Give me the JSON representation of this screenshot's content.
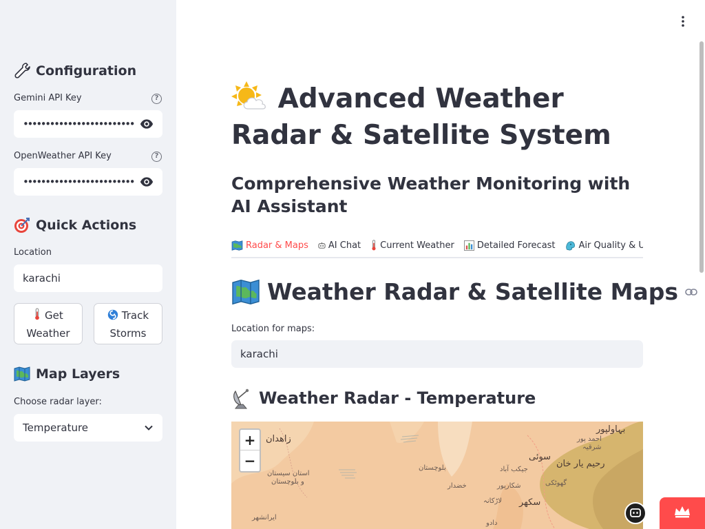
{
  "sidebar": {
    "configuration_title": "Configuration",
    "gemini_label": "Gemini API Key",
    "gemini_value": "••••••••••••••••••••••••••••••••••••",
    "openweather_label": "OpenWeather API Key",
    "openweather_value": "••••••••••••••••••••••••••••••••••••",
    "quick_actions_title": "Quick Actions",
    "location_label": "Location",
    "location_value": "karachi",
    "get_weather_line1": "Get",
    "get_weather_line2": "Weather",
    "track_storms_line1": "Track",
    "track_storms_line2": "Storms",
    "map_layers_title": "Map Layers",
    "radar_layer_label": "Choose radar layer:",
    "radar_layer_value": "Temperature"
  },
  "main": {
    "title": "Advanced Weather Radar & Satellite System",
    "subtitle": "Comprehensive Weather Monitoring with AI Assistant",
    "tabs": [
      {
        "label": "Radar & Maps",
        "active": true
      },
      {
        "label": "AI Chat",
        "active": false
      },
      {
        "label": "Current Weather",
        "active": false
      },
      {
        "label": "Detailed Forecast",
        "active": false
      },
      {
        "label": "Air Quality & UV",
        "active": false
      }
    ],
    "section_title": "Weather Radar & Satellite Maps",
    "maps_location_label": "Location for maps:",
    "maps_location_value": "karachi",
    "radar_title": "Weather Radar - Temperature"
  },
  "map": {
    "zoom_in": "+",
    "zoom_out": "−",
    "labels": [
      "زاهدان",
      "بلوچستان",
      "استان سیستان",
      "و بلوچستان",
      "ایرانشهر",
      "خضدار",
      "سوئی",
      "جیکب آباد",
      "رحیم یار خان",
      "شکارپور",
      "سکھر",
      "لاڑکانہ",
      "گھوٹکی",
      "دادو",
      "بہاولپور",
      "احمد پور",
      "شرقیہ"
    ]
  },
  "colors": {
    "accent": "#ff4b4b",
    "sidebar_bg": "#f0f2f6",
    "text": "#31333f"
  },
  "icons": {
    "configuration": "wrench-icon",
    "quick_actions": "target-icon",
    "map_layers": "map-icon",
    "title": "sun-behind-cloud-icon",
    "radar": "satellite-dish-icon",
    "link": "link-icon"
  }
}
